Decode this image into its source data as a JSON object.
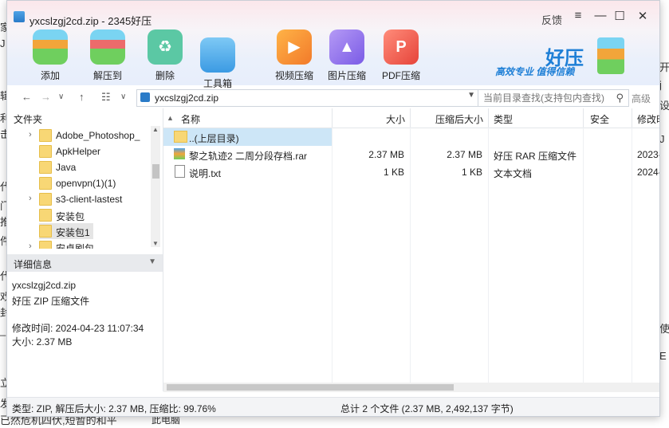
{
  "background": {
    "left_chars": [
      "家",
      "J",
      "辑",
      "利",
      "击",
      "代",
      "门",
      "[",
      "推",
      "件",
      "代",
      "戏",
      "封",
      "技",
      "_",
      "f",
      "立",
      "迁",
      "的",
      "发"
    ],
    "right_chars": [
      "开",
      "j",
      "设",
      "J",
      "使",
      "E",
      "E",
      "C",
      "I",
      "B",
      "t"
    ],
    "bottom_text": "已然危机四伏,短暂的和平",
    "bottom_item": "此电脑"
  },
  "window": {
    "title": "yxcslzgj2cd.zip - 2345好压",
    "feedback": "反馈",
    "controls": {
      "menu": "≡",
      "minimize": "—",
      "maximize": "☐",
      "close": "✕"
    }
  },
  "toolbar": [
    {
      "name": "add",
      "label": "添加"
    },
    {
      "name": "extract",
      "label": "解压到"
    },
    {
      "name": "delete",
      "label": "删除"
    },
    {
      "name": "toolbox",
      "label": "工具箱"
    },
    {
      "name": "video-compress",
      "label": "视频压缩"
    },
    {
      "name": "image-compress",
      "label": "图片压缩"
    },
    {
      "name": "pdf-compress",
      "label": "PDF压缩"
    }
  ],
  "brand": {
    "name": "好压",
    "slogan": "高效专业 值得信赖"
  },
  "nav": {
    "back": "←",
    "forward": "→",
    "dropdown": "∨",
    "up": "↑",
    "view": "☷",
    "path": "yxcslzgj2cd.zip",
    "search_placeholder": "当前目录查找(支持包内查找)",
    "advanced": "高级"
  },
  "tree": {
    "header": "文件夹",
    "items": [
      {
        "label": "Adobe_Photoshop_",
        "expandable": true
      },
      {
        "label": "ApkHelper",
        "expandable": false
      },
      {
        "label": "Java",
        "expandable": false
      },
      {
        "label": "openvpn(1)(1)",
        "expandable": false
      },
      {
        "label": "s3-client-lastest",
        "expandable": true
      },
      {
        "label": "安装包",
        "expandable": false
      },
      {
        "label": "安装包1",
        "expandable": false
      },
      {
        "label": "安卓刷包",
        "expandable": true
      }
    ]
  },
  "details": {
    "header": "详细信息",
    "filename": "yxcslzgj2cd.zip",
    "type": "好压 ZIP 压缩文件",
    "modified": "修改时间: 2024-04-23 11:07:34",
    "size": "大小: 2.37 MB"
  },
  "columns": {
    "name": "名称",
    "size": "大小",
    "packed": "压缩后大小",
    "type": "类型",
    "security": "安全",
    "modified": "修改时"
  },
  "files": [
    {
      "icon": "folder",
      "name": "..(上层目录)",
      "size": "",
      "packed": "",
      "type": "",
      "modified": ""
    },
    {
      "icon": "rar",
      "name": "黎之轨迹2 二周分段存档.rar",
      "size": "2.37 MB",
      "packed": "2.37 MB",
      "type": "好压 RAR 压缩文件",
      "modified": "2023-"
    },
    {
      "icon": "txt",
      "name": "说明.txt",
      "size": "1 KB",
      "packed": "1 KB",
      "type": "文本文档",
      "modified": "2024-"
    }
  ],
  "status": {
    "left": "类型: ZIP, 解压后大小: 2.37 MB, 压缩比: 99.76%",
    "right": "总计 2 个文件 (2.37 MB, 2,492,137 字节)"
  }
}
